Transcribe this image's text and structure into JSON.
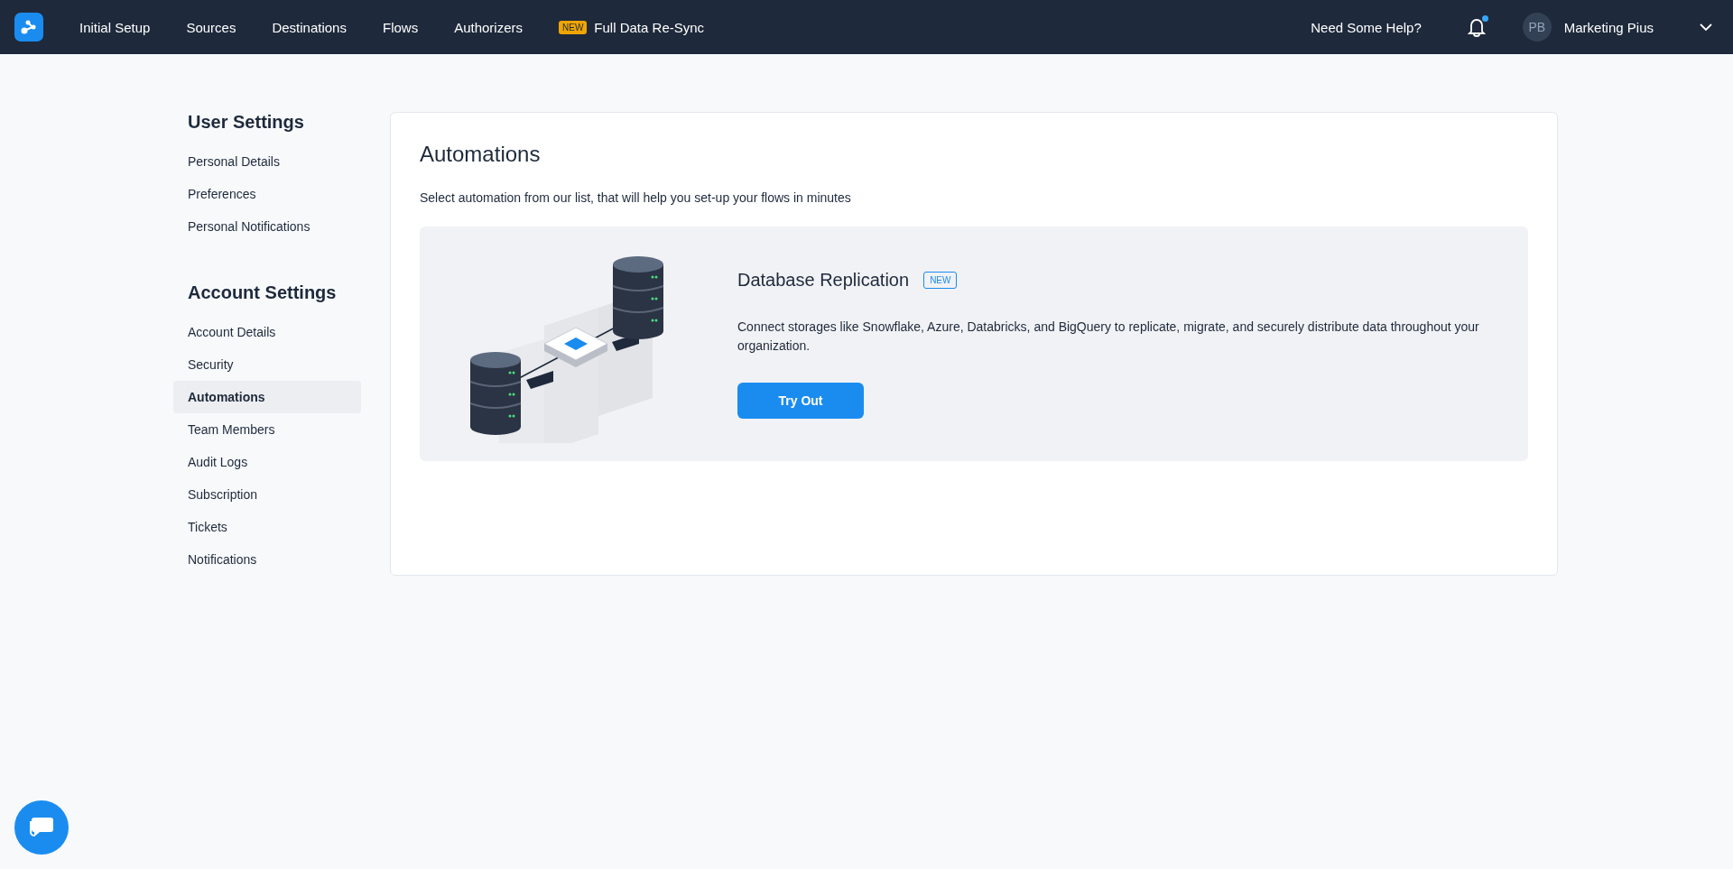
{
  "nav": {
    "items": [
      {
        "label": "Initial Setup"
      },
      {
        "label": "Sources"
      },
      {
        "label": "Destinations"
      },
      {
        "label": "Flows"
      },
      {
        "label": "Authorizers"
      },
      {
        "label": "Full Data Re-Sync",
        "badge": "NEW"
      }
    ],
    "help": "Need Some Help?",
    "notifications": {
      "unread": true
    },
    "user": {
      "initials": "PB",
      "name": "Marketing Pius"
    }
  },
  "sidebar": {
    "sections": [
      {
        "title": "User Settings",
        "items": [
          {
            "label": "Personal Details",
            "selected": false
          },
          {
            "label": "Preferences",
            "selected": false
          },
          {
            "label": "Personal Notifications",
            "selected": false
          }
        ]
      },
      {
        "title": "Account Settings",
        "items": [
          {
            "label": "Account Details",
            "selected": false
          },
          {
            "label": "Security",
            "selected": false
          },
          {
            "label": "Automations",
            "selected": true
          },
          {
            "label": "Team Members",
            "selected": false
          },
          {
            "label": "Audit Logs",
            "selected": false
          },
          {
            "label": "Subscription",
            "selected": false
          },
          {
            "label": "Tickets",
            "selected": false
          },
          {
            "label": "Notifications",
            "selected": false
          }
        ]
      }
    ]
  },
  "main": {
    "title": "Automations",
    "subtitle": "Select automation from our list, that will help you set-up your flows in minutes",
    "automations": [
      {
        "title": "Database Replication",
        "badge": "NEW",
        "description": "Connect storages like Snowflake, Azure, Databricks, and BigQuery to replicate, migrate, and securely distribute data throughout your organization.",
        "button": "Try Out"
      }
    ]
  }
}
